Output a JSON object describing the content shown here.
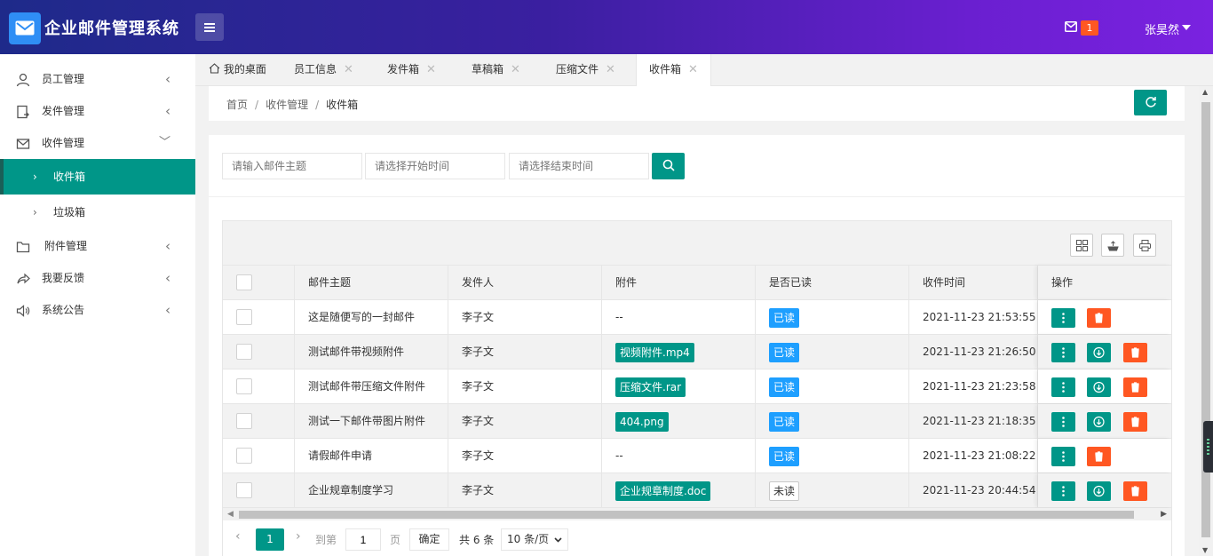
{
  "app": {
    "title": "企业邮件管理系统"
  },
  "header": {
    "mail_badge": "1",
    "user_name": "张昊然"
  },
  "sidebar": {
    "items": [
      {
        "label": "员工管理",
        "icon": "user-icon"
      },
      {
        "label": "发件管理",
        "icon": "send-file-icon"
      },
      {
        "label": "收件管理",
        "icon": "mail-icon"
      },
      {
        "label": "附件管理",
        "icon": "folder-icon"
      },
      {
        "label": "我要反馈",
        "icon": "share-icon"
      },
      {
        "label": "系统公告",
        "icon": "speaker-icon"
      }
    ],
    "subitems": [
      {
        "label": "收件箱",
        "active": true
      },
      {
        "label": "垃圾箱",
        "active": false
      }
    ]
  },
  "tabs": [
    {
      "label": "我的桌面"
    },
    {
      "label": "员工信息"
    },
    {
      "label": "发件箱"
    },
    {
      "label": "草稿箱"
    },
    {
      "label": "压缩文件"
    },
    {
      "label": "收件箱"
    }
  ],
  "breadcrumb": {
    "home": "首页",
    "section": "收件管理",
    "current": "收件箱",
    "separator": "/"
  },
  "search": {
    "subject_placeholder": "请输入邮件主题",
    "start_placeholder": "请选择开始时间",
    "end_placeholder": "请选择结束时间"
  },
  "table": {
    "columns": [
      "邮件主题",
      "发件人",
      "附件",
      "是否已读",
      "收件时间",
      "操作"
    ],
    "rows": [
      {
        "subject": "这是随便写的一封邮件",
        "sender": "李子文",
        "attachment": "--",
        "read": "已读",
        "time": "2021-11-23 21:53:55"
      },
      {
        "subject": "测试邮件带视频附件",
        "sender": "李子文",
        "attachment": "视频附件.mp4",
        "read": "已读",
        "time": "2021-11-23 21:26:50"
      },
      {
        "subject": "测试邮件带压缩文件附件",
        "sender": "李子文",
        "attachment": "压缩文件.rar",
        "read": "已读",
        "time": "2021-11-23 21:23:58"
      },
      {
        "subject": "测试一下邮件带图片附件",
        "sender": "李子文",
        "attachment": "404.png",
        "read": "已读",
        "time": "2021-11-23 21:18:35"
      },
      {
        "subject": "请假邮件申请",
        "sender": "李子文",
        "attachment": "--",
        "read": "已读",
        "time": "2021-11-23 21:08:22"
      },
      {
        "subject": "企业规章制度学习",
        "sender": "李子文",
        "attachment": "企业规章制度.doc",
        "read": "未读",
        "time": "2021-11-23 20:44:54"
      }
    ]
  },
  "pager": {
    "current_page": "1",
    "goto_label": "到第",
    "page_unit": "页",
    "goto_value": "1",
    "confirm": "确定",
    "total": "共 6 条",
    "page_size": "10 条/页"
  },
  "colors": {
    "primary": "#009688",
    "danger": "#ff5722",
    "info": "#1e9fff"
  }
}
